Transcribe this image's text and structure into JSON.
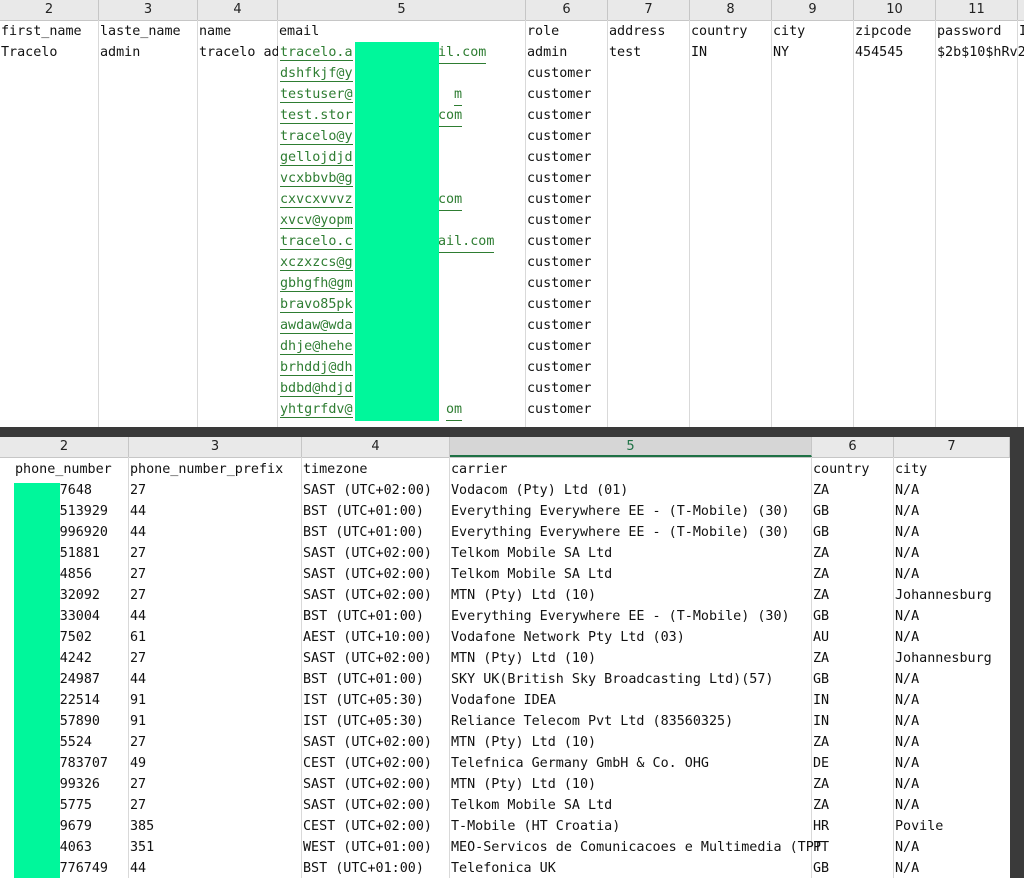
{
  "sheet1": {
    "col_numbers": [
      "2",
      "3",
      "4",
      "5",
      "6",
      "7",
      "8",
      "9",
      "10",
      "11",
      "1"
    ],
    "headers": [
      "first_name",
      "laste_name",
      "name",
      "email",
      "role",
      "address",
      "country",
      "city",
      "zipcode",
      "password",
      "I"
    ],
    "row1": {
      "first_name": "Tracelo",
      "laste_name": "admin",
      "name": "tracelo ad",
      "address": "test",
      "country": "IN",
      "city": "NY",
      "zipcode": "454545",
      "password": "$2b$10$hRv2"
    },
    "emails": [
      {
        "left": "tracelo.a",
        "right": "il.com"
      },
      {
        "left": "dshfkjf@y",
        "right": ""
      },
      {
        "left": "testuser@",
        "right": "m"
      },
      {
        "left": "test.stor",
        "right": "com"
      },
      {
        "left": "tracelo@y",
        "right": ""
      },
      {
        "left": "gellojdjd",
        "right": ""
      },
      {
        "left": "vcxbbvb@g",
        "right": ""
      },
      {
        "left": "cxvcxvvvz",
        "right": "com"
      },
      {
        "left": "xvcv@yopm",
        "right": ""
      },
      {
        "left": "tracelo.c",
        "right": "ail.com"
      },
      {
        "left": "xczxzcs@g",
        "right": ""
      },
      {
        "left": "gbhgfh@gm",
        "right": ""
      },
      {
        "left": "bravo85pk",
        "right": ""
      },
      {
        "left": "awdaw@wda",
        "right": ""
      },
      {
        "left": "dhje@hehe",
        "right": ""
      },
      {
        "left": "brhddj@dh",
        "right": ""
      },
      {
        "left": "bdbd@hdjd",
        "right": ""
      },
      {
        "left": "yhtgrfdv@",
        "right": "om"
      }
    ],
    "roles": [
      "admin",
      "customer",
      "customer",
      "customer",
      "customer",
      "customer",
      "customer",
      "customer",
      "customer",
      "customer",
      "customer",
      "customer",
      "customer",
      "customer",
      "customer",
      "customer",
      "customer",
      "customer"
    ]
  },
  "sheet2": {
    "col_numbers": [
      "2",
      "3",
      "4",
      "5",
      "6",
      "7"
    ],
    "headers": [
      "phone_number",
      "phone_number_prefix",
      "timezone",
      "carrier",
      "country",
      "city"
    ],
    "rows": [
      {
        "phone": "7648",
        "prefix": "27",
        "tz": "SAST (UTC+02:00)",
        "carrier": "Vodacom (Pty) Ltd (01)",
        "country": "ZA",
        "city": "N/A"
      },
      {
        "phone": "513929",
        "prefix": "44",
        "tz": "BST (UTC+01:00)",
        "carrier": "Everything Everywhere EE - (T-Mobile) (30)",
        "country": "GB",
        "city": "N/A"
      },
      {
        "phone": "996920",
        "prefix": "44",
        "tz": "BST (UTC+01:00)",
        "carrier": "Everything Everywhere EE - (T-Mobile) (30)",
        "country": "GB",
        "city": "N/A"
      },
      {
        "phone": "51881",
        "prefix": "27",
        "tz": "SAST (UTC+02:00)",
        "carrier": "Telkom Mobile SA Ltd",
        "country": "ZA",
        "city": "N/A"
      },
      {
        "phone": "4856",
        "prefix": "27",
        "tz": "SAST (UTC+02:00)",
        "carrier": "Telkom Mobile SA Ltd",
        "country": "ZA",
        "city": "N/A"
      },
      {
        "phone": "32092",
        "prefix": "27",
        "tz": "SAST (UTC+02:00)",
        "carrier": "MTN (Pty) Ltd (10)",
        "country": "ZA",
        "city": "Johannesburg"
      },
      {
        "phone": "33004",
        "prefix": "44",
        "tz": "BST (UTC+01:00)",
        "carrier": "Everything Everywhere EE - (T-Mobile) (30)",
        "country": "GB",
        "city": "N/A"
      },
      {
        "phone": "7502",
        "prefix": "61",
        "tz": "AEST (UTC+10:00)",
        "carrier": "Vodafone Network Pty Ltd (03)",
        "country": "AU",
        "city": "N/A"
      },
      {
        "phone": "4242",
        "prefix": "27",
        "tz": "SAST (UTC+02:00)",
        "carrier": "MTN (Pty) Ltd (10)",
        "country": "ZA",
        "city": "Johannesburg"
      },
      {
        "phone": "24987",
        "prefix": "44",
        "tz": "BST (UTC+01:00)",
        "carrier": "SKY UK(British Sky Broadcasting Ltd)(57)",
        "country": "GB",
        "city": "N/A"
      },
      {
        "phone": "22514",
        "prefix": "91",
        "tz": "IST (UTC+05:30)",
        "carrier": "Vodafone IDEA",
        "country": "IN",
        "city": "N/A"
      },
      {
        "phone": "57890",
        "prefix": "91",
        "tz": "IST (UTC+05:30)",
        "carrier": "Reliance Telecom Pvt Ltd (83560325)",
        "country": "IN",
        "city": "N/A"
      },
      {
        "phone": "5524",
        "prefix": "27",
        "tz": "SAST (UTC+02:00)",
        "carrier": "MTN (Pty) Ltd (10)",
        "country": "ZA",
        "city": "N/A"
      },
      {
        "phone": "783707",
        "prefix": "49",
        "tz": "CEST (UTC+02:00)",
        "carrier": "Telefnica Germany GmbH & Co. OHG",
        "country": "DE",
        "city": "N/A"
      },
      {
        "phone": "99326",
        "prefix": "27",
        "tz": "SAST (UTC+02:00)",
        "carrier": "MTN (Pty) Ltd (10)",
        "country": "ZA",
        "city": "N/A"
      },
      {
        "phone": "5775",
        "prefix": "27",
        "tz": "SAST (UTC+02:00)",
        "carrier": "Telkom Mobile SA Ltd",
        "country": "ZA",
        "city": "N/A"
      },
      {
        "phone": "9679",
        "prefix": "385",
        "tz": "CEST (UTC+02:00)",
        "carrier": "T-Mobile (HT Croatia)",
        "country": "HR",
        "city": "Povile"
      },
      {
        "phone": "4063",
        "prefix": "351",
        "tz": "WEST (UTC+01:00)",
        "carrier": "MEO-Servicos de Comunicacoes e Multimedia (TPT",
        "country": "PT",
        "city": "N/A"
      },
      {
        "phone": "776749",
        "prefix": "44",
        "tz": "BST (UTC+01:00)",
        "carrier": "Telefonica UK",
        "country": "GB",
        "city": "N/A"
      }
    ]
  },
  "colors": {
    "link": "#2e7d32",
    "redaction": "#00f79b",
    "header_bg": "#e9e9e9",
    "gap": "#3a3a3a"
  }
}
